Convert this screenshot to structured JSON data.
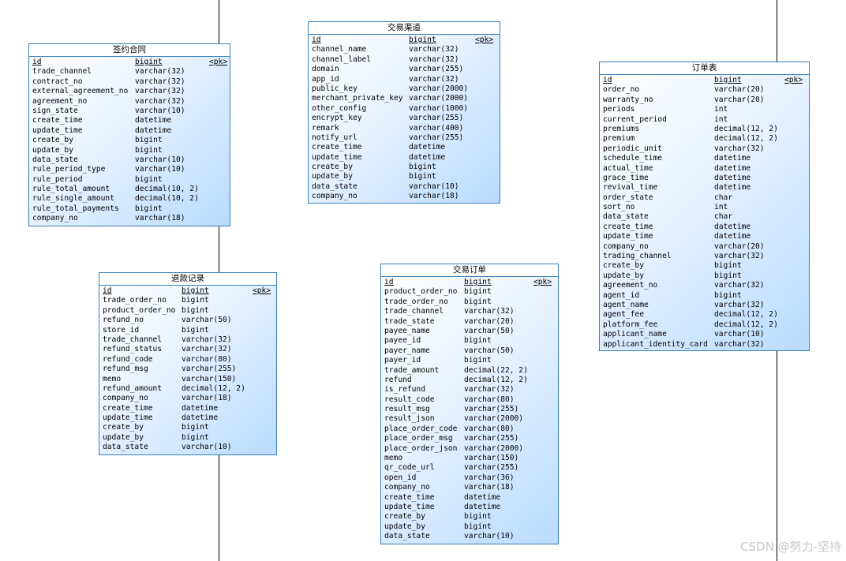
{
  "entities": [
    {
      "id": "sign-contract",
      "title": "签约合同",
      "columns": [
        [
          "id",
          "bigint",
          "<pk>"
        ],
        [
          "trade_channel",
          "varchar(32)"
        ],
        [
          "contract_no",
          "varchar(32)"
        ],
        [
          "external_agreement_no",
          "varchar(32)"
        ],
        [
          "agreement_no",
          "varchar(32)"
        ],
        [
          "sign_state",
          "varchar(10)"
        ],
        [
          "create_time",
          "datetime"
        ],
        [
          "update_time",
          "datetime"
        ],
        [
          "create_by",
          "bigint"
        ],
        [
          "update_by",
          "bigint"
        ],
        [
          "data_state",
          "varchar(10)"
        ],
        [
          "rule_period_type",
          "varchar(10)"
        ],
        [
          "rule_period",
          "bigint"
        ],
        [
          "rule_total_amount",
          "decimal(10, 2)"
        ],
        [
          "rule_single_amount",
          "decimal(10, 2)"
        ],
        [
          "rule_total_payments",
          "bigint"
        ],
        [
          "company_no",
          "varchar(18)"
        ]
      ]
    },
    {
      "id": "trade-channel",
      "title": "交易渠道",
      "columns": [
        [
          "id",
          "bigint",
          "<pk>"
        ],
        [
          "channel_name",
          "varchar(32)"
        ],
        [
          "channel_label",
          "varchar(32)"
        ],
        [
          "domain",
          "varchar(255)"
        ],
        [
          "app_id",
          "varchar(32)"
        ],
        [
          "public_key",
          "varchar(2000)"
        ],
        [
          "merchant_private_key",
          "varchar(2000)"
        ],
        [
          "other_config",
          "varchar(1000)"
        ],
        [
          "encrypt_key",
          "varchar(255)"
        ],
        [
          "remark",
          "varchar(400)"
        ],
        [
          "notify_url",
          "varchar(255)"
        ],
        [
          "create_time",
          "datetime"
        ],
        [
          "update_time",
          "datetime"
        ],
        [
          "create_by",
          "bigint"
        ],
        [
          "update_by",
          "bigint"
        ],
        [
          "data_state",
          "varchar(10)"
        ],
        [
          "company_no",
          "varchar(18)"
        ]
      ]
    },
    {
      "id": "order-table",
      "title": "订单表",
      "columns": [
        [
          "id",
          "bigint",
          "<pk>"
        ],
        [
          "order_no",
          "varchar(20)"
        ],
        [
          "warranty_no",
          "varchar(20)"
        ],
        [
          "periods",
          "int"
        ],
        [
          "current_period",
          "int"
        ],
        [
          "premiums",
          "decimal(12, 2)"
        ],
        [
          "premium",
          "decimal(12, 2)"
        ],
        [
          "periodic_unit",
          "varchar(32)"
        ],
        [
          "schedule_time",
          "datetime"
        ],
        [
          "actual_time",
          "datetime"
        ],
        [
          "grace_time",
          "datetime"
        ],
        [
          "revival_time",
          "datetime"
        ],
        [
          "order_state",
          "char"
        ],
        [
          "sort_no",
          "int"
        ],
        [
          "data_state",
          "char"
        ],
        [
          "create_time",
          "datetime"
        ],
        [
          "update_time",
          "datetime"
        ],
        [
          "company_no",
          "varchar(20)"
        ],
        [
          "trading_channel",
          "varchar(32)"
        ],
        [
          "create_by",
          "bigint"
        ],
        [
          "update_by",
          "bigint"
        ],
        [
          "agreement_no",
          "varchar(32)"
        ],
        [
          "agent_id",
          "bigint"
        ],
        [
          "agent_name",
          "varchar(32)"
        ],
        [
          "agent_fee",
          "decimal(12, 2)"
        ],
        [
          "platform_fee",
          "decimal(12, 2)"
        ],
        [
          "applicant_name",
          "varchar(10)"
        ],
        [
          "applicant_identity_card",
          "varchar(32)"
        ]
      ]
    },
    {
      "id": "refund-record",
      "title": "退款记录",
      "columns": [
        [
          "id",
          "bigint",
          "<pk>"
        ],
        [
          "trade_order_no",
          "bigint"
        ],
        [
          "product_order_no",
          "bigint"
        ],
        [
          "refund_no",
          "varchar(50)"
        ],
        [
          "store_id",
          "bigint"
        ],
        [
          "trade_channel",
          "varchar(32)"
        ],
        [
          "refund_status",
          "varchar(32)"
        ],
        [
          "refund_code",
          "varchar(80)"
        ],
        [
          "refund_msg",
          "varchar(255)"
        ],
        [
          "memo",
          "varchar(150)"
        ],
        [
          "refund_amount",
          "decimal(12, 2)"
        ],
        [
          "company_no",
          "varchar(18)"
        ],
        [
          "create_time",
          "datetime"
        ],
        [
          "update_time",
          "datetime"
        ],
        [
          "create_by",
          "bigint"
        ],
        [
          "update_by",
          "bigint"
        ],
        [
          "data_state",
          "varchar(10)"
        ]
      ]
    },
    {
      "id": "trade-order",
      "title": "交易订单",
      "columns": [
        [
          "id",
          "bigint",
          "<pk>"
        ],
        [
          "product_order_no",
          "bigint"
        ],
        [
          "trade_order_no",
          "bigint"
        ],
        [
          "trade_channel",
          "varchar(32)"
        ],
        [
          "trade_state",
          "varchar(20)"
        ],
        [
          "payee_name",
          "varchar(50)"
        ],
        [
          "payee_id",
          "bigint"
        ],
        [
          "payer_name",
          "varchar(50)"
        ],
        [
          "payer_id",
          "bigint"
        ],
        [
          "trade_amount",
          "decimal(22, 2)"
        ],
        [
          "refund",
          "decimal(12, 2)"
        ],
        [
          "is_refund",
          "varchar(32)"
        ],
        [
          "result_code",
          "varchar(80)"
        ],
        [
          "result_msg",
          "varchar(255)"
        ],
        [
          "result_json",
          "varchar(2000)"
        ],
        [
          "place_order_code",
          "varchar(80)"
        ],
        [
          "place_order_msg",
          "varchar(255)"
        ],
        [
          "place_order_json",
          "varchar(2000)"
        ],
        [
          "memo",
          "varchar(150)"
        ],
        [
          "qr_code_url",
          "varchar(255)"
        ],
        [
          "open_id",
          "varchar(36)"
        ],
        [
          "company_no",
          "varchar(18)"
        ],
        [
          "create_time",
          "datetime"
        ],
        [
          "update_time",
          "datetime"
        ],
        [
          "create_by",
          "bigint"
        ],
        [
          "update_by",
          "bigint"
        ],
        [
          "data_state",
          "varchar(10)"
        ]
      ]
    }
  ],
  "watermark": "CSDN @努力-坚持"
}
